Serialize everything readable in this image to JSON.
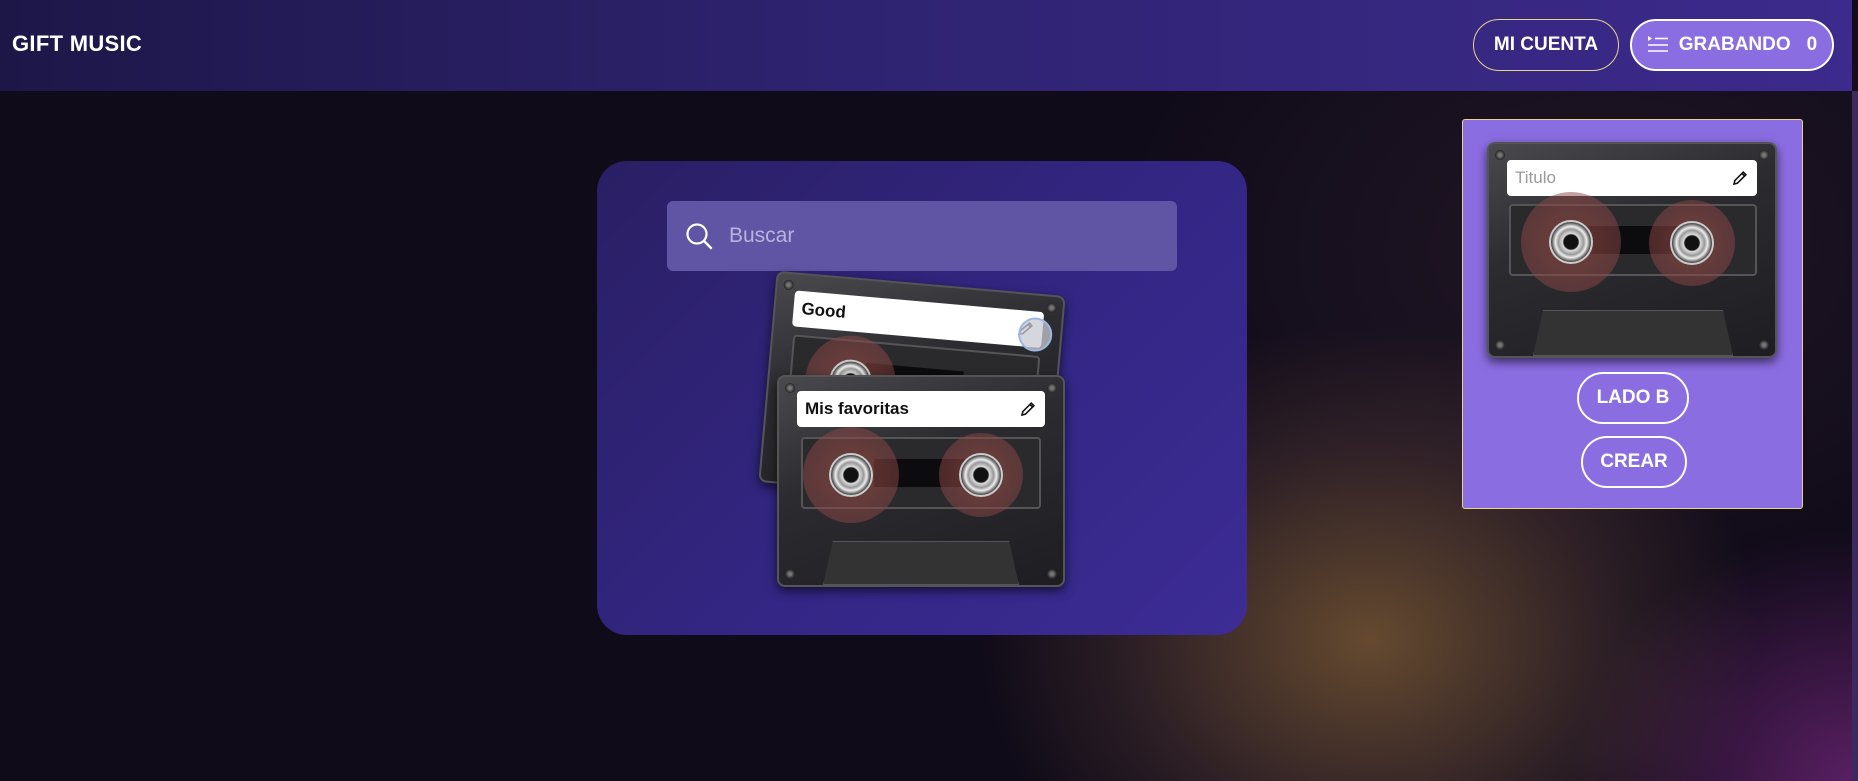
{
  "app": {
    "title": "GIFT MUSIC"
  },
  "header": {
    "account_label": "MI CUENTA",
    "recording_label": "GRABANDO",
    "recording_count": "0",
    "recording_icon": "playlist-icon"
  },
  "search": {
    "placeholder": "Buscar",
    "icon": "search-icon"
  },
  "cassettes": [
    {
      "label": "Good",
      "edit_icon": "pencil-icon"
    },
    {
      "label": "Mis favoritas",
      "edit_icon": "pencil-icon"
    }
  ],
  "editor": {
    "title_placeholder": "Titulo",
    "side_b_label": "LADO B",
    "create_label": "CREAR"
  },
  "colors": {
    "accent": "#8b6de2",
    "border_gold": "#e9d28a",
    "card_bg": "#2f2578",
    "header_bg": "#2e2370"
  }
}
